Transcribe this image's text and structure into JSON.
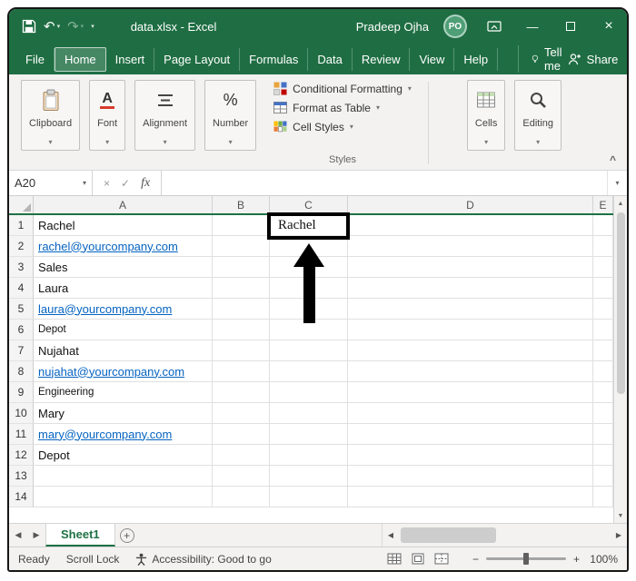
{
  "colors": {
    "accent_green": "#1E7145",
    "titlebar_green": "#1F6E43",
    "link_blue": "#0563C1"
  },
  "icons": {
    "dropdown": "▾",
    "undo": "↶",
    "redo": "↷",
    "minimize": "—",
    "close": "×",
    "cancel": "×",
    "enter": "✓",
    "function": "fx",
    "scroll_up": "▲",
    "scroll_down": "▼",
    "scroll_left": "◀",
    "scroll_right": "▶",
    "tab_nav_left": "◀",
    "tab_nav_right": "▶",
    "add_sheet": "+",
    "collapse_ribbon": "^",
    "zoom_out": "−",
    "zoom_in": "+",
    "percent": "%",
    "font_letter": "A"
  },
  "titlebar": {
    "title": "data.xlsx - Excel",
    "user": "Pradeep Ojha",
    "avatar": "PO"
  },
  "ribbon": {
    "tabs": [
      "File",
      "Home",
      "Insert",
      "Page Layout",
      "Formulas",
      "Data",
      "Review",
      "View",
      "Help"
    ],
    "active_tab": "Home",
    "tell_me": "Tell me",
    "share": "Share",
    "groups": {
      "clipboard": "Clipboard",
      "font": "Font",
      "alignment": "Alignment",
      "number": "Number",
      "styles": "Styles",
      "cells": "Cells",
      "editing": "Editing"
    },
    "styles_items": [
      "Conditional Formatting",
      "Format as Table",
      "Cell Styles"
    ]
  },
  "formula_bar": {
    "name_box": "A20",
    "formula": ""
  },
  "grid": {
    "column_headers": [
      "A",
      "B",
      "C",
      "D",
      "E"
    ],
    "rows": [
      {
        "n": "1",
        "A": "Rachel",
        "C": "Rachel"
      },
      {
        "n": "2",
        "A": "rachel@yourcompany.com"
      },
      {
        "n": "3",
        "A": "Sales"
      },
      {
        "n": "4",
        "A": "Laura"
      },
      {
        "n": "5",
        "A": "laura@yourcompany.com"
      },
      {
        "n": "6",
        "A": "Depot"
      },
      {
        "n": "7",
        "A": "Nujahat"
      },
      {
        "n": "8",
        "A": "nujahat@yourcompany.com"
      },
      {
        "n": "9",
        "A": "Engineering"
      },
      {
        "n": "10",
        "A": "Mary"
      },
      {
        "n": "11",
        "A": "mary@yourcompany.com"
      },
      {
        "n": "12",
        "A": "Depot"
      },
      {
        "n": "13"
      },
      {
        "n": "14"
      }
    ]
  },
  "sheet_bar": {
    "active_sheet": "Sheet1"
  },
  "status_bar": {
    "mode": "Ready",
    "scroll_lock": "Scroll Lock",
    "accessibility": "Accessibility: Good to go",
    "zoom_level": "100%"
  }
}
